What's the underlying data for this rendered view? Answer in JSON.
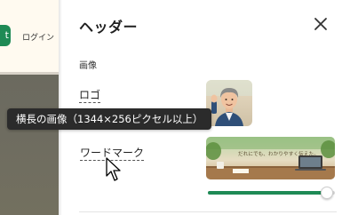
{
  "background_app": {
    "green_button_label": "t",
    "login_label": "ログイン"
  },
  "panel": {
    "title": "ヘッダー",
    "close_icon": "close-icon",
    "section_label": "画像",
    "logo_label": "ロゴ",
    "wordmark_label": "ワードマーク",
    "wordmark_image_text": "だれにでも、わかりやすく伝えた。",
    "slider_level_percent": 94
  },
  "tooltip": {
    "text": "横長の画像（1344×256ピクセル以上）"
  },
  "colors": {
    "accent": "#1e8a55",
    "tooltip_bg": "#2b2b2b"
  }
}
